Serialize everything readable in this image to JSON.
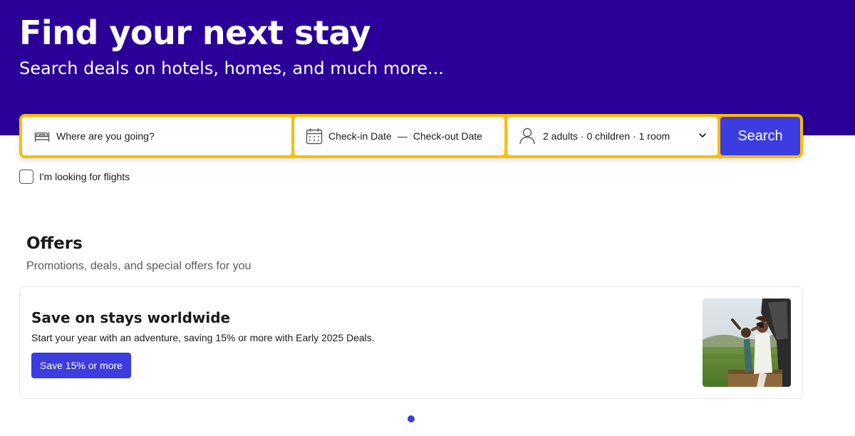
{
  "hero": {
    "title": "Find your next stay",
    "subtitle": "Search deals on hotels, homes, and much more..."
  },
  "search": {
    "destination_placeholder": "Where are you going?",
    "checkin_placeholder": "Check-in Date",
    "date_separator": "—",
    "checkout_placeholder": "Check-out Date",
    "occupancy": "2 adults · 0 children · 1 room",
    "button_label": "Search"
  },
  "flights_checkbox": {
    "label": "I'm looking for flights",
    "checked": false
  },
  "offers": {
    "title": "Offers",
    "subtitle": "Promotions, deals, and special offers for you",
    "card": {
      "title": "Save on stays worldwide",
      "text": "Start your year with an adventure, saving 15% or more with Early 2025 Deals.",
      "button_label": "Save 15% or more",
      "image_icon": "safari-photo"
    }
  },
  "carousel": {
    "current_page": 1,
    "total_pages": 1
  },
  "colors": {
    "brand_navy": "#2a0099",
    "accent_yellow": "#febb02",
    "button_blue": "#3c3ce0"
  }
}
